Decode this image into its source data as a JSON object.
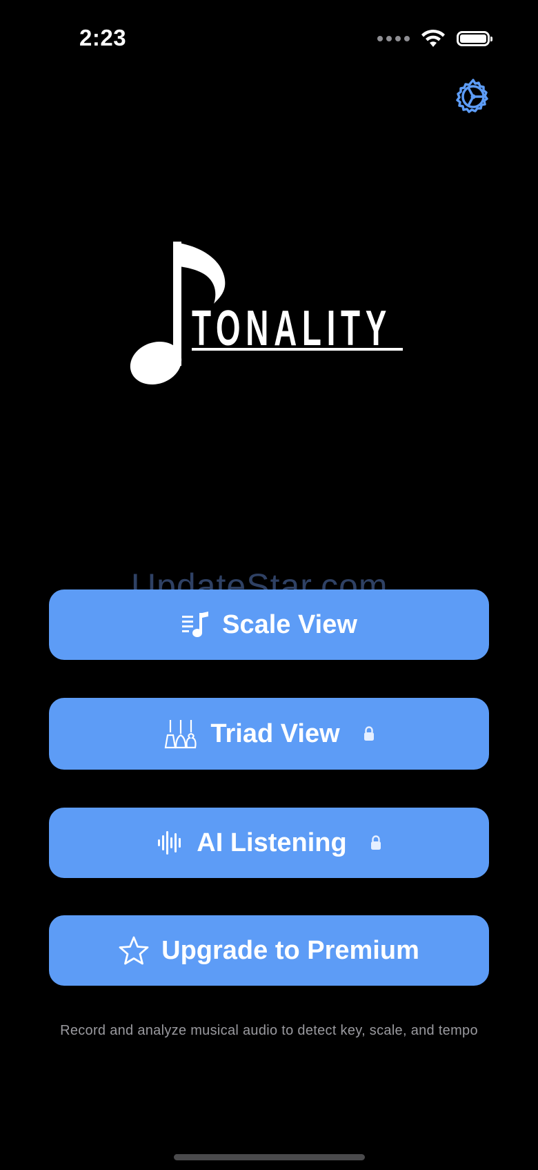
{
  "status_bar": {
    "time": "2:23"
  },
  "app": {
    "logo_text": "TONALITY",
    "watermark": "UpdateStar.com",
    "accent_color": "#5d9cf6",
    "background_color": "#000000"
  },
  "menu": {
    "items": [
      {
        "label": "Scale View",
        "icon": "music-list-icon",
        "locked": false
      },
      {
        "label": "Triad View",
        "icon": "guitars-icon",
        "locked": true
      },
      {
        "label": "AI Listening",
        "icon": "waveform-icon",
        "locked": true
      },
      {
        "label": "Upgrade to Premium",
        "icon": "star-icon",
        "locked": false
      }
    ]
  },
  "footer": {
    "caption": "Record and analyze musical audio to detect key, scale, and tempo"
  }
}
